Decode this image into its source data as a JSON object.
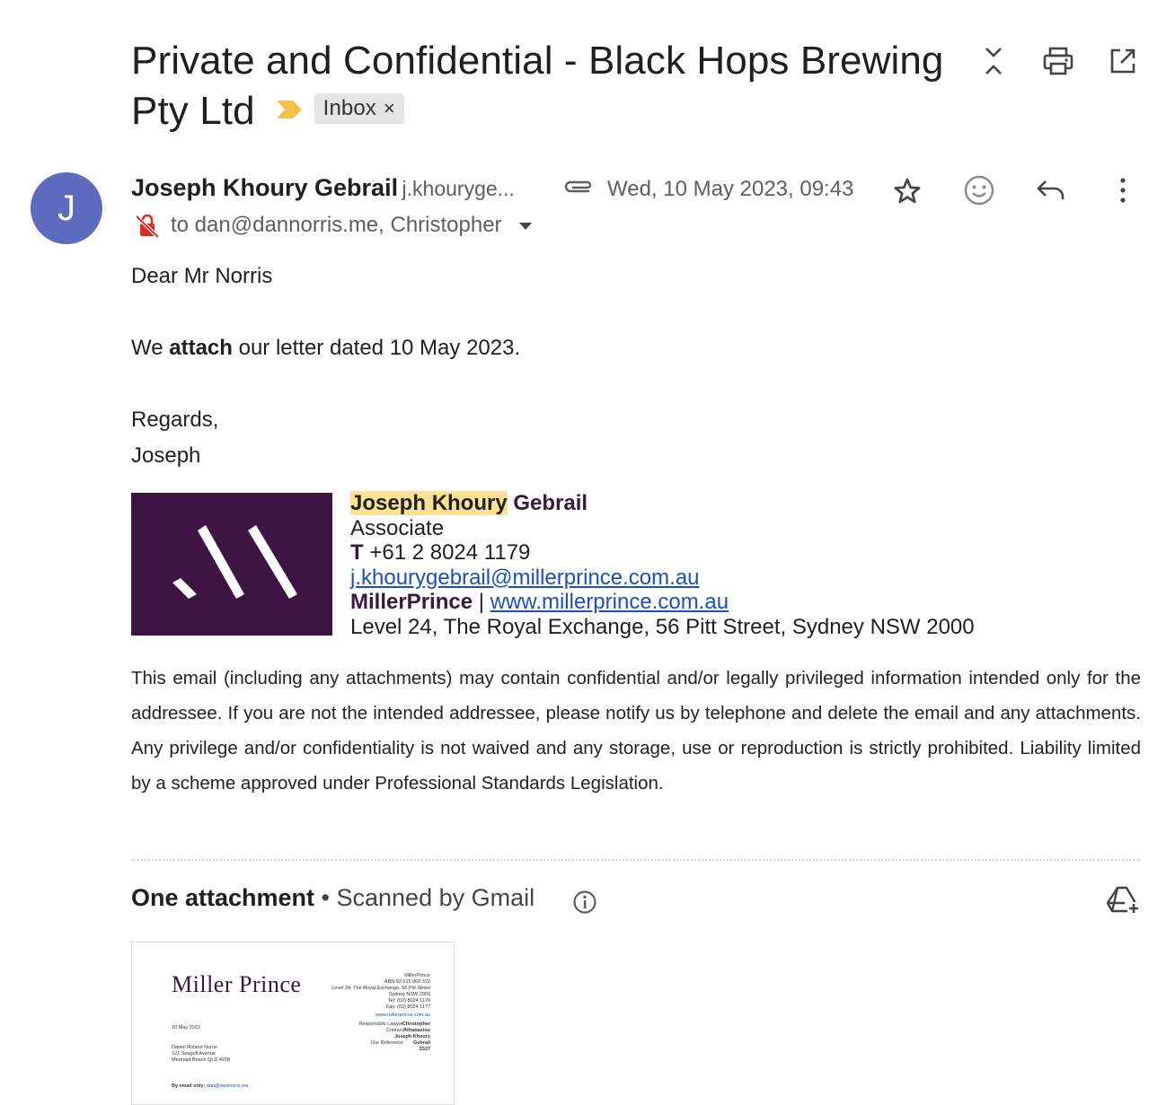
{
  "email": {
    "subject": "Private and Confidential - Black Hops Brewing Pty Ltd",
    "label": "Inbox",
    "label_remove": "×",
    "sender": {
      "initial": "J",
      "name": "Joseph Khoury Gebrail",
      "email_truncated": "j.khouryge..."
    },
    "date": "Wed, 10 May 2023, 09:43",
    "to": "to dan@dannorris.me, Christopher",
    "body": {
      "greeting": "Dear Mr Norris",
      "line_pre": "We ",
      "line_bold": "attach",
      "line_post": " our letter dated 10 May 2023.",
      "regards": "Regards,",
      "signoff": "Joseph"
    },
    "signature": {
      "name_highlight": "Joseph Khoury",
      "name_rest": " Gebrail",
      "role": "Associate",
      "phone_label": "T",
      "phone": " +61 2 8024 1179",
      "email": "j.khourygebrail@millerprince.com.au",
      "firm": "MillerPrince",
      "separator": " | ",
      "website": "www.millerprince.com.au",
      "address": "Level 24, The Royal Exchange, 56 Pitt Street, Sydney NSW 2000"
    },
    "disclaimer": "This email (including any attachments) may contain confidential and/or legally privileged information intended only for the addressee. If you are not the intended addressee, please notify us by telephone and delete the email and any attachments. Any privilege and/or confidentiality is not waived and any storage, use or reproduction is strictly prohibited. Liability limited by a scheme approved under Professional Standards Legislation."
  },
  "attachments": {
    "heading": "One attachment",
    "scan_note": " • Scanned by Gmail",
    "thumbnail": {
      "logo": "Miller Prince",
      "firm_block": "MillerPrince\nABN 62 015 060 372\nLevel 24, The Royal Exchange, 56 Pitt Street\nSydney NSW 2000\nTel: (02) 8024 1179\nFax: (02) 8024 1177",
      "website": "www.millerprince.com.au",
      "ref_labels": "Responsible Lawyer\nContact\n\nOur Reference",
      "ref_values": "Christopher\nAthanasiou\nJoseph Khoury\nGebrail\n2327",
      "date": "10 May 2023",
      "recipient": "Daniel Roland Norris\n121 Seagull Avenue\nMermaid Beach  QLD 4218",
      "by_email_label": "By email only:",
      "by_email_value": "dan@dannorris.me"
    }
  },
  "colors": {
    "avatar": "#5c6bc0",
    "brand": "#3e1443",
    "importance": "#f4c14a",
    "highlight": "#fde293",
    "link": "#1a4fc4"
  },
  "icons": [
    "importance-marker-icon",
    "collapse-expand-icon",
    "print-icon",
    "open-in-new-window-icon",
    "attachment-clip-icon",
    "star-icon",
    "emoji-reaction-icon",
    "reply-icon",
    "more-options-icon",
    "encryption-warning-icon",
    "recipient-details-chevron-icon",
    "info-icon",
    "add-to-drive-icon"
  ]
}
